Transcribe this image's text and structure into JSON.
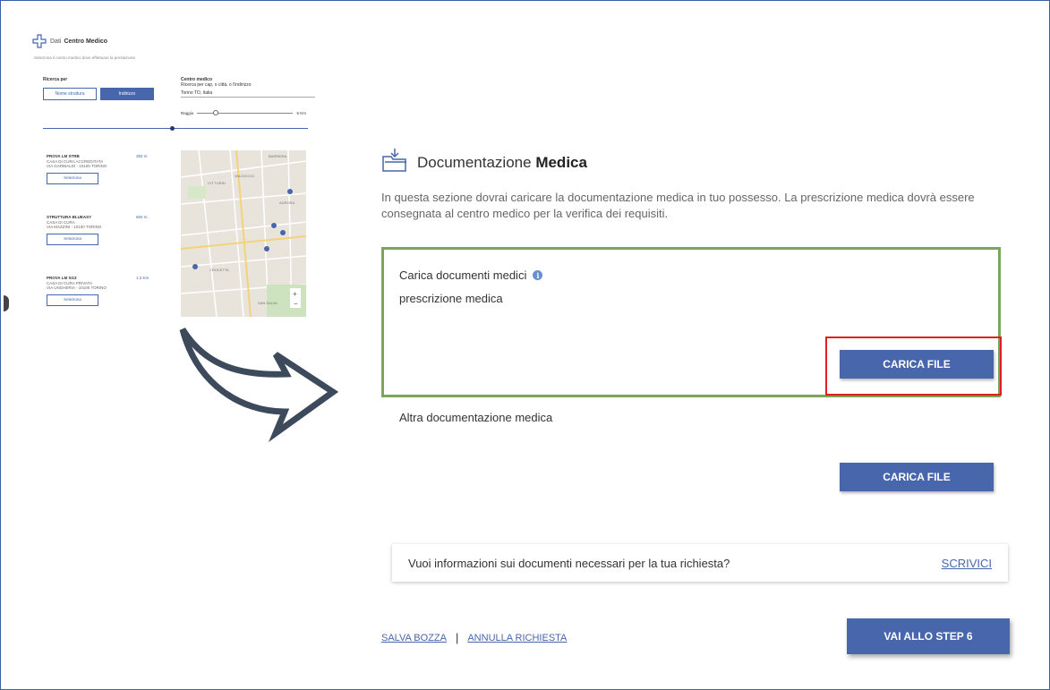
{
  "mini_panel": {
    "title_prefix": "Dati",
    "title_bold": "Centro Medico",
    "subtitle": "Seleziona il centro medico dove effettuare la prestazione",
    "search_label": "Ricerca per",
    "btn_name": "Nome struttura",
    "btn_address": "Indirizzo",
    "center_label": "Centro medico",
    "center_hint": "Ricerca per cap, o città, o l'indirizzo",
    "center_value": "Torino TO, Italia",
    "radius_label": "Raggio",
    "radius_value": "5 Km",
    "results": [
      {
        "name": "PROVA LM STRB",
        "type": "CASA DI CURA ACCREDITATA",
        "address": "VIA GARIBALDI - 10100 TORINO",
        "distance": "350 m",
        "select": "Seleziona"
      },
      {
        "name": "STRUTTURA BLUEASY",
        "type": "CASA DI CURA",
        "address": "VIA MAZZINI - 10100 TORINO",
        "distance": "650 m",
        "select": "Seleziona"
      },
      {
        "name": "PROVA LM SG3",
        "type": "CASA DI CURA PRIVATA",
        "address": "VIA UNGHERIA - 10100 TORINO",
        "distance": "1,2 Km",
        "select": "Seleziona"
      }
    ],
    "map_labels": [
      "BARRIERA",
      "VALDOCCO",
      "AURORA",
      "CIT TURIN",
      "CROCETTA",
      "SAN SALVA"
    ]
  },
  "section": {
    "title_light": "Documentazione",
    "title_bold": "Medica",
    "description": "In questa sezione dovrai caricare la documentazione medica in tuo possesso. La prescrizione medica dovrà essere consegnata al centro medico per la verifica dei requisiti.",
    "upload_label": "Carica documenti medici",
    "info_glyph": "i",
    "prescription_label": "prescrizione medica",
    "upload_button": "CARICA FILE",
    "other_label": "Altra documentazione medica",
    "other_button": "CARICA FILE"
  },
  "info_bar": {
    "question": "Vuoi informazioni sui documenti necessari per la tua richiesta?",
    "link": "SCRIVICI"
  },
  "footer": {
    "save_draft": "SALVA BOZZA",
    "separator": "|",
    "cancel_request": "ANNULLA RICHIESTA",
    "next_step": "VAI ALLO STEP 6"
  },
  "colors": {
    "primary": "#4766ab",
    "highlight_border": "#7ba55d",
    "annotation_red": "#e02020",
    "arrow": "#3d4a5c"
  }
}
